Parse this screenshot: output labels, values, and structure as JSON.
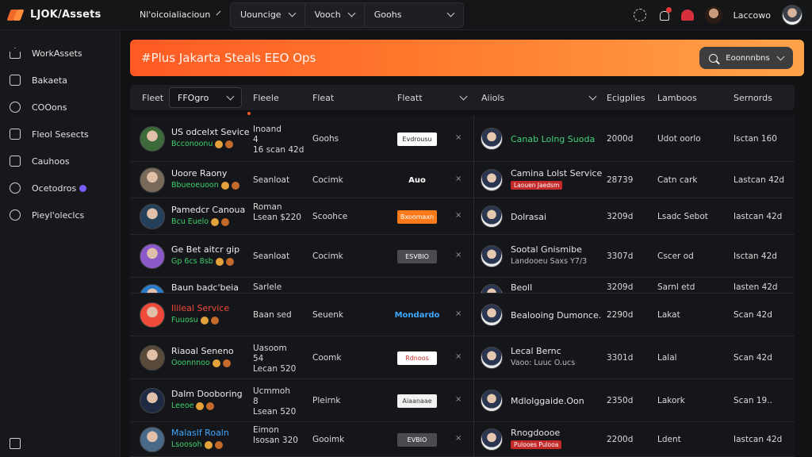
{
  "app": {
    "name": "LJOK/Assets"
  },
  "topbar": {
    "location_select": "Nl'oicoialiacioun",
    "group": [
      {
        "label": "Uouncige",
        "has_chevron": true
      },
      {
        "label": "Vooch",
        "has_chevron": true
      },
      {
        "label": "Goohs",
        "has_chevron": true
      }
    ],
    "user_name": "Laccowo",
    "icons": [
      "loading-icon",
      "bell-icon",
      "heart-icon"
    ]
  },
  "sidebar": {
    "items": [
      {
        "label": "WorkAssets",
        "icon": "home-icon"
      },
      {
        "label": "Bakaeta",
        "icon": "square-icon"
      },
      {
        "label": "COOons",
        "icon": "shield-icon"
      },
      {
        "label": "Fleol Sesects",
        "icon": "document-icon"
      },
      {
        "label": "Cauhoos",
        "icon": "calendar-icon"
      },
      {
        "label": "Ocetodros",
        "icon": "circle-icon",
        "badge": true
      },
      {
        "label": "Pieyl'oleclcs",
        "icon": "pin-icon"
      }
    ]
  },
  "banner": {
    "title": "#Plus Jakarta  Steals EEO Ops",
    "button_label": "Eoonnnbns"
  },
  "filterbar": {
    "label": "Fleet",
    "select_value": "FFOgro",
    "columns": [
      "Fleele",
      "Fleat",
      "Fleatt",
      "Aiiols",
      "Ecigplies",
      "Lamboos",
      "Sernords"
    ]
  },
  "rows": [
    {
      "name": "US odcelxt Sevice",
      "sub": "Bcconoonu",
      "name_color": "default",
      "col1a": "Inoand",
      "col1b": "4",
      "col1c": "16 scan 42d",
      "col2": "Goohs",
      "logo_text": "Evdrousu",
      "logo_bg": "#ffffff",
      "logo_fg": "#222",
      "asset": "Canab Lolng Suoda",
      "asset_color": "green",
      "asset_tag": "",
      "v1": "2000d",
      "v2": "Udot oorlo",
      "v3": "Isctan 160",
      "avatar_bg": "#3c6a3a"
    },
    {
      "name": "Uoore Raony",
      "sub": "Bbueoeuoon",
      "name_color": "default",
      "col1a": "Seanloat",
      "col1b": "",
      "col1c": "",
      "col2": "Cocimk",
      "logo_text": "Auo",
      "logo_bg": "#151619",
      "logo_fg": "#fff",
      "asset": "Camina Lolst Service",
      "asset_color": "default",
      "asset_tag": "Laouen Jaedsm",
      "v1": "28739",
      "v2": "Catn cark",
      "v3": "Lastcan 42d",
      "avatar_bg": "#7a6a5a"
    },
    {
      "name": "Pamedcr Canoua",
      "sub": "Bcu Euelo",
      "name_color": "default",
      "col1a": "Roman",
      "col1b": "",
      "col1c": "Lsean $220",
      "col2": "Scoohce",
      "logo_text": "Bxoomaxn",
      "logo_bg": "#ff7a1a",
      "logo_fg": "#fff",
      "asset": "Dolrasai",
      "asset_color": "default",
      "asset_tag": "",
      "v1": "3209d",
      "v2": "Lsadc Sebot",
      "v3": "Iastcan 42d",
      "avatar_bg": "#25405a"
    },
    {
      "name": "Ge Bet aitcr gip",
      "sub": "Gp 6cs 8sb",
      "name_color": "default",
      "col1a": "Seanloat",
      "col1b": "",
      "col1c": "",
      "col2": "Cocimk",
      "logo_text": "ESVBIO",
      "logo_bg": "#4a4b50",
      "logo_fg": "#fff",
      "asset": "Sootal Gnismibe",
      "asset_color": "default",
      "asset_tag": "",
      "asset_sub": "Landooeu Saxs  Y7/3",
      "v1": "3307d",
      "v2": "Cscer od",
      "v3": "Isctan 42d",
      "avatar_bg": "#8a5ac8"
    },
    {
      "name": "Baun badc'beia",
      "sub": "",
      "name_color": "default",
      "col1a": "Sarlele",
      "col1b": "",
      "col1c": "",
      "col2": "",
      "logo_text": "",
      "logo_bg": "",
      "logo_fg": "",
      "asset": "Beoll",
      "asset_color": "default",
      "asset_tag": "",
      "v1": "3209d",
      "v2": "Sarnl etd",
      "v3": "Iasten 42d",
      "avatar_bg": "#2a7acb",
      "partial": true
    },
    {
      "name": "Ilileal Service",
      "sub": "Fuuosu",
      "name_color": "red",
      "col1a": "Baan sed",
      "col1b": "",
      "col1c": "",
      "col2": "Seuenk",
      "logo_text": "Mondardo",
      "logo_bg": "#151619",
      "logo_fg": "#3fa8ff",
      "asset": "Bealooing Dumonce.",
      "asset_color": "default",
      "asset_tag": "",
      "v1": "2290d",
      "v2": "Lakat",
      "v3": "Scan 42d",
      "avatar_bg": "#f04a3a"
    },
    {
      "name": "Riaoal Seneno",
      "sub": "Ooonnnoo",
      "name_color": "default",
      "col1a": "Uasoom",
      "col1b": "54",
      "col1c": "Lecan 520",
      "col2": "Coomk",
      "logo_text": "Rdnoos",
      "logo_bg": "#ffffff",
      "logo_fg": "#c42a2a",
      "asset": "Lecal Bernc",
      "asset_color": "default",
      "asset_tag": "",
      "asset_sub": "Vaoo:  Luuc O.ucs",
      "v1": "3301d",
      "v2": "Lalal",
      "v3": "Scan 42d",
      "avatar_bg": "#5a4a3a"
    },
    {
      "name": "Dalm Dooboring",
      "sub": "Leeoe",
      "name_color": "default",
      "col1a": "Ucmmoh",
      "col1b": "8",
      "col1c": "Lsean 520",
      "col2": "Pleirnk",
      "logo_text": "Aiaanaae",
      "logo_bg": "#f2f2f2",
      "logo_fg": "#333",
      "asset": "Mdlolggaide.Oon",
      "asset_color": "default",
      "asset_tag": "",
      "v1": "2350d",
      "v2": "Lakork",
      "v3": "Scan 19..",
      "avatar_bg": "#1e2a44"
    },
    {
      "name": "Malaslf Roaln",
      "sub": "Lsoosoh",
      "name_color": "blue",
      "col1a": "Eimon",
      "col1b": "",
      "col1c": "Isosan 320",
      "col2": "Gooimk",
      "logo_text": "EVBIO",
      "logo_bg": "#4a4b50",
      "logo_fg": "#fff",
      "asset": "Rnogdoooe",
      "asset_color": "default",
      "asset_tag": "Pulooes Pulooa",
      "v1": "2200d",
      "v2": "Ldent",
      "v3": "Iastcan 42d",
      "avatar_bg": "#4a6a8a"
    }
  ]
}
